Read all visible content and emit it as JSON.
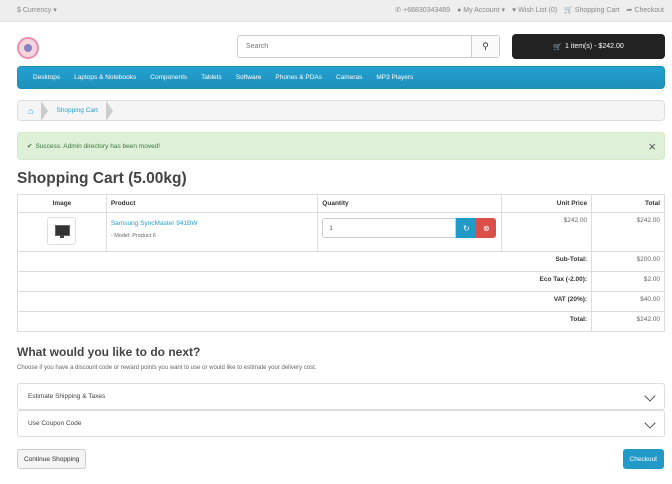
{
  "topbar": {
    "currency": "$ Currency",
    "phone": "+66830343489",
    "account": "My Account",
    "wishlist": "Wish List (0)",
    "shopping_cart": "Shopping Cart",
    "checkout": "Checkout"
  },
  "header": {
    "search_placeholder": "Search",
    "cart_button": "1 item(s) - $242.00"
  },
  "menu": [
    "Desktops",
    "Laptops & Notebooks",
    "Components",
    "Tablets",
    "Software",
    "Phones & PDAs",
    "Cameras",
    "MP3 Players"
  ],
  "breadcrumb": {
    "current": "Shopping Cart"
  },
  "alert": {
    "message": "Success: Admin directory has been moved!"
  },
  "page_title": "Shopping Cart  (5.00kg)",
  "table": {
    "headers": {
      "image": "Image",
      "product": "Product",
      "quantity": "Quantity",
      "unit_price": "Unit Price",
      "total": "Total"
    },
    "item": {
      "name": "Samsung SyncMaster 941BW",
      "model": "- Model: Product 6",
      "quantity": "1",
      "unit_price": "$242.00",
      "total": "$242.00"
    },
    "totals": [
      {
        "label": "Sub-Total:",
        "value": "$200.00"
      },
      {
        "label": "Eco Tax (-2.00):",
        "value": "$2.00"
      },
      {
        "label": "VAT (20%):",
        "value": "$40.00"
      },
      {
        "label": "Total:",
        "value": "$242.00"
      }
    ]
  },
  "next": {
    "heading": "What would you like to do next?",
    "hint": "Choose if you have a discount code or reward points you want to use or would like to estimate your delivery cost.",
    "panel_shipping": "Estimate Shipping & Taxes",
    "panel_coupon": "Use Coupon Code"
  },
  "buttons": {
    "continue": "Continue Shopping",
    "checkout": "Checkout"
  }
}
